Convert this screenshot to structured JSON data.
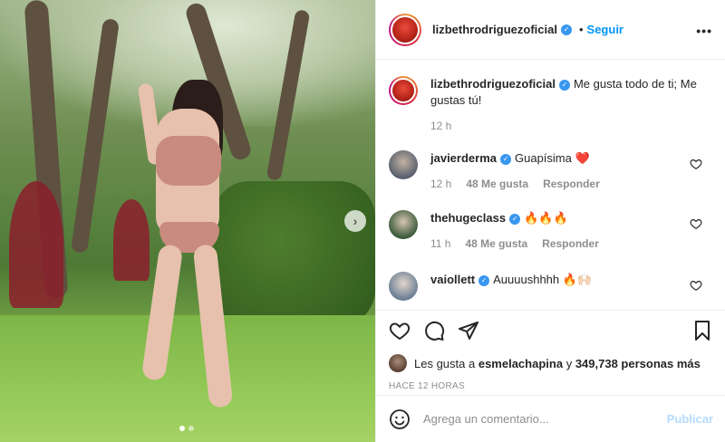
{
  "post": {
    "author": "lizbethrodriguezoficial",
    "follow_label": "Seguir",
    "separator": "•",
    "more_label": "•••",
    "caption_text": "Me gusta todo de ti; Me gustas tú!",
    "caption_time": "12 h"
  },
  "comments": [
    {
      "user": "javierderma",
      "text": "Guapísima ❤️",
      "time": "12 h",
      "likes": "48 Me gusta",
      "reply": "Responder"
    },
    {
      "user": "thehugeclass",
      "text": "🔥🔥🔥",
      "time": "11 h",
      "likes": "48 Me gusta",
      "reply": "Responder"
    },
    {
      "user": "vaiollett",
      "text": "Auuuushhhh 🔥🙌🏻",
      "time": "",
      "likes": "",
      "reply": ""
    }
  ],
  "likes": {
    "prefix": "Les gusta a",
    "first_user": "esmelachapina",
    "joiner": "y",
    "count_text": "349,738 personas más"
  },
  "posted_time": "HACE 12 HORAS",
  "comment_box": {
    "placeholder": "Agrega un comentario...",
    "publish_label": "Publicar"
  },
  "carousel": {
    "next_label": "›"
  },
  "colors": {
    "link_blue": "#0095f6",
    "publish_disabled": "#b3dbff",
    "verified": "#3897f0"
  }
}
